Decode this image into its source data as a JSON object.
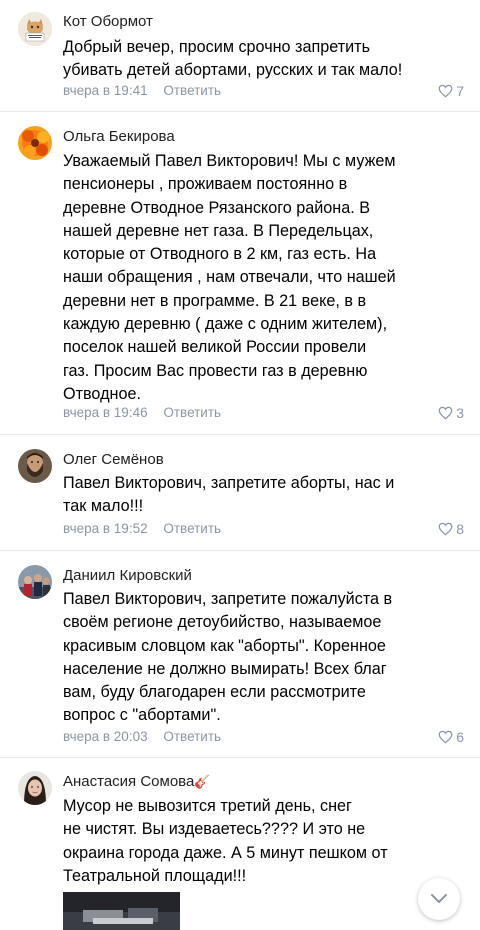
{
  "comments": [
    {
      "author": "Кот Обормот",
      "lines": [
        "Добрый вечер, просим срочно запретить",
        "убивать детей абортами, русских и так мало!"
      ],
      "time": "вчера в 19:41",
      "reply": "Ответить",
      "likes": "7",
      "avatar_icon": "cat-avatar"
    },
    {
      "author": "Ольга Бекирова",
      "lines": [
        "Уважаемый Павел Викторович! Мы с мужем",
        "пенсионеры , проживаем постоянно в",
        "деревне Отводное Рязанского района.  В",
        "нашей деревне нет газа. В Передельцах,",
        "которые от Отводного в 2 км, газ есть. На",
        "наши обращения , нам отвечали, что нашей",
        "деревни нет в программе. В 21 веке, в  в",
        "каждую деревню ( даже с одним жителем),",
        "поселок нашей великой России провели",
        "газ. Просим Вас провести газ в деревню",
        "Отводное."
      ],
      "time": "вчера в 19:46",
      "reply": "Ответить",
      "likes": "3",
      "avatar_icon": "flower-avatar"
    },
    {
      "author": "Олег Семёнов",
      "lines": [
        "Павел Викторович, запретите аборты, нас и",
        "так мало!!!"
      ],
      "time": "вчера в 19:52",
      "reply": "Ответить",
      "likes": "8",
      "avatar_icon": "bearded-man-avatar"
    },
    {
      "author": "Даниил Кировский",
      "lines": [
        "Павел Викторович, запретите пожалуйста в",
        "своём регионе детоубийство, называемое",
        "красивым словцом как \"аборты\". Коренное",
        "население не должно вымирать! Всех благ",
        "вам, буду благодарен если рассмотрите",
        "вопрос с \"абортами\"."
      ],
      "time": "вчера в 20:03",
      "reply": "Ответить",
      "likes": "6",
      "avatar_icon": "group-photo-avatar"
    },
    {
      "author": "Анастасия Сомова",
      "author_emoji": "🎸",
      "lines": [
        "Мусор не вывозится третий день, снег",
        "не чистят. Вы издеваетесь???? И это не",
        "окраина города даже. А 5 минут пешком от",
        "Театральной площади!!!"
      ],
      "avatar_icon": "woman-avatar"
    }
  ],
  "scroll_button_icon": "chevron-down-icon"
}
